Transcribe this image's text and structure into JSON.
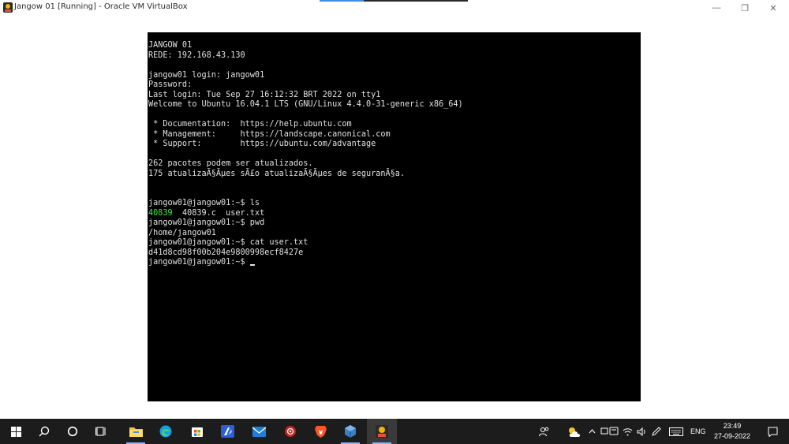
{
  "window": {
    "title": "Jangow 01 [Running] - Oracle VM VirtualBox",
    "progress_percent": 30,
    "minimize_glyph": "—",
    "maximize_glyph": "❐",
    "close_glyph": "✕"
  },
  "terminal": {
    "lines": [
      "JANGOW 01",
      "REDE: 192.168.43.130",
      "",
      "jangow01 login: jangow01",
      "Password:",
      "Last login: Tue Sep 27 16:12:32 BRT 2022 on tty1",
      "Welcome to Ubuntu 16.04.1 LTS (GNU/Linux 4.4.0-31-generic x86_64)",
      "",
      " * Documentation:  https://help.ubuntu.com",
      " * Management:     https://landscape.canonical.com",
      " * Support:        https://ubuntu.com/advantage",
      "",
      "262 pacotes podem ser atualizados.",
      "175 atualizaÃ§Ãµes sÃ£o atualizaÃ§Ãµes de seguranÃ§a.",
      "",
      "",
      "jangow01@jangow01:~$ ls"
    ],
    "ls_executable": "40839",
    "ls_rest": "  40839.c  user.txt",
    "lines_after": [
      "jangow01@jangow01:~$ pwd",
      "/home/jangow01",
      "jangow01@jangow01:~$ cat user.txt",
      "d41d8cd98f00b204e9800998ecf8427e"
    ],
    "prompt": "jangow01@jangow01:~$ "
  },
  "taskbar": {
    "icons": [
      "windows-start-icon",
      "search-icon",
      "cortana-icon",
      "task-view-icon",
      "file-explorer-icon",
      "edge-icon",
      "microsoft-store-icon",
      "powerautomate-icon",
      "mail-icon",
      "antivirus-icon",
      "brave-icon",
      "virtualbox-icon",
      "jangow-vm-icon"
    ],
    "language": "ENG",
    "time": "23:49",
    "date": "27-09-2022"
  },
  "colors": {
    "console_bg": "#000000",
    "console_text": "#e0e0e0",
    "executable_green": "#3df03d",
    "taskbar_bg": "#1c1c1c"
  }
}
